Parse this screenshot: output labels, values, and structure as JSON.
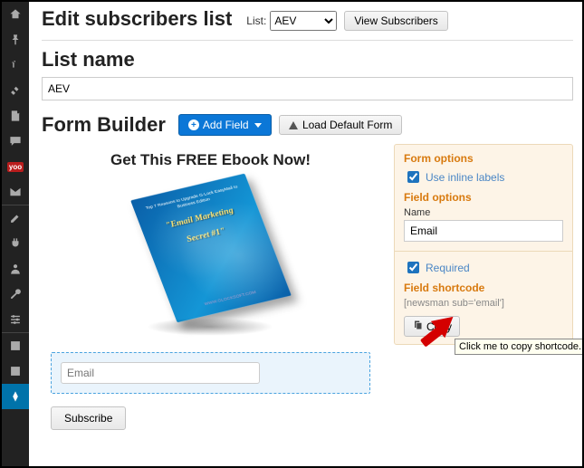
{
  "header": {
    "title": "Edit subscribers list",
    "list_label": "List:",
    "list_selected": "AEV",
    "view_subscribers": "View Subscribers"
  },
  "list_name": {
    "heading": "List name",
    "value": "AEV"
  },
  "form_builder": {
    "heading": "Form Builder",
    "add_field": "Add Field",
    "load_default": "Load Default Form"
  },
  "preview": {
    "title": "Get This FREE Ebook Now!",
    "book_topline": "Top 7 Reasons to Upgrade\nG-Lock EasyMail to Business Edition",
    "book_ribbon1": "\"Email Marketing",
    "book_ribbon2": "Secret #1\"",
    "book_site": "WWW.GLOCKSOFT.COM",
    "email_placeholder": "Email",
    "subscribe": "Subscribe"
  },
  "side": {
    "form_options": "Form options",
    "use_inline": "Use inline labels",
    "field_options": "Field options",
    "name_label": "Name",
    "name_value": "Email",
    "required": "Required",
    "field_shortcode": "Field shortcode",
    "shortcode_value": "[newsman sub='email']",
    "copy": "Copy"
  },
  "tooltip": "Click me to copy shortcode.",
  "sidebar": {
    "yoo": "yoo"
  }
}
